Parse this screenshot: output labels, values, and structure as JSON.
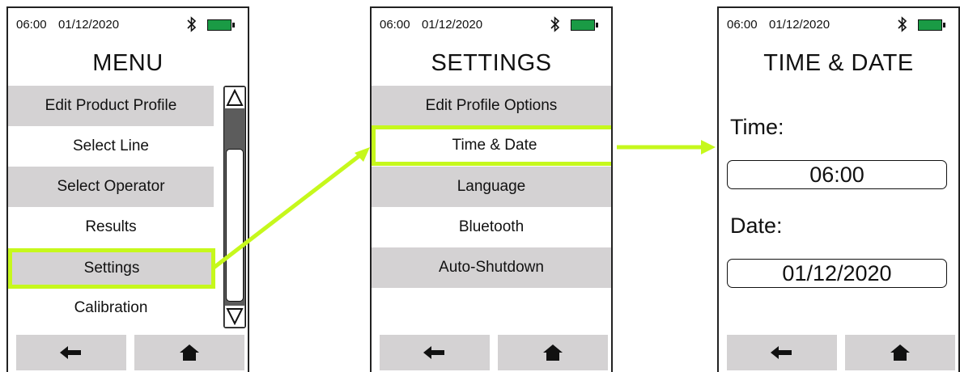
{
  "status": {
    "time": "06:00",
    "date": "01/12/2020"
  },
  "menu": {
    "title": "MENU",
    "items": [
      {
        "label": "Edit Product Profile"
      },
      {
        "label": "Select Line"
      },
      {
        "label": "Select Operator"
      },
      {
        "label": "Results"
      },
      {
        "label": "Settings"
      },
      {
        "label": "Calibration"
      }
    ]
  },
  "settings": {
    "title": "SETTINGS",
    "items": [
      {
        "label": "Edit Profile Options"
      },
      {
        "label": "Time & Date"
      },
      {
        "label": "Language"
      },
      {
        "label": "Bluetooth"
      },
      {
        "label": "Auto-Shutdown"
      }
    ]
  },
  "time_date": {
    "title": "TIME & DATE",
    "time_label": "Time:",
    "time_value": "06:00",
    "date_label": "Date:",
    "date_value": "01/12/2020"
  },
  "icons": {
    "back": "back-arrow-icon",
    "home": "home-icon",
    "bluetooth": "bluetooth-icon",
    "battery": "battery-icon"
  },
  "colors": {
    "highlight": "#c6f81c",
    "battery": "#1a9b45",
    "row_gray": "#d4d2d3"
  }
}
